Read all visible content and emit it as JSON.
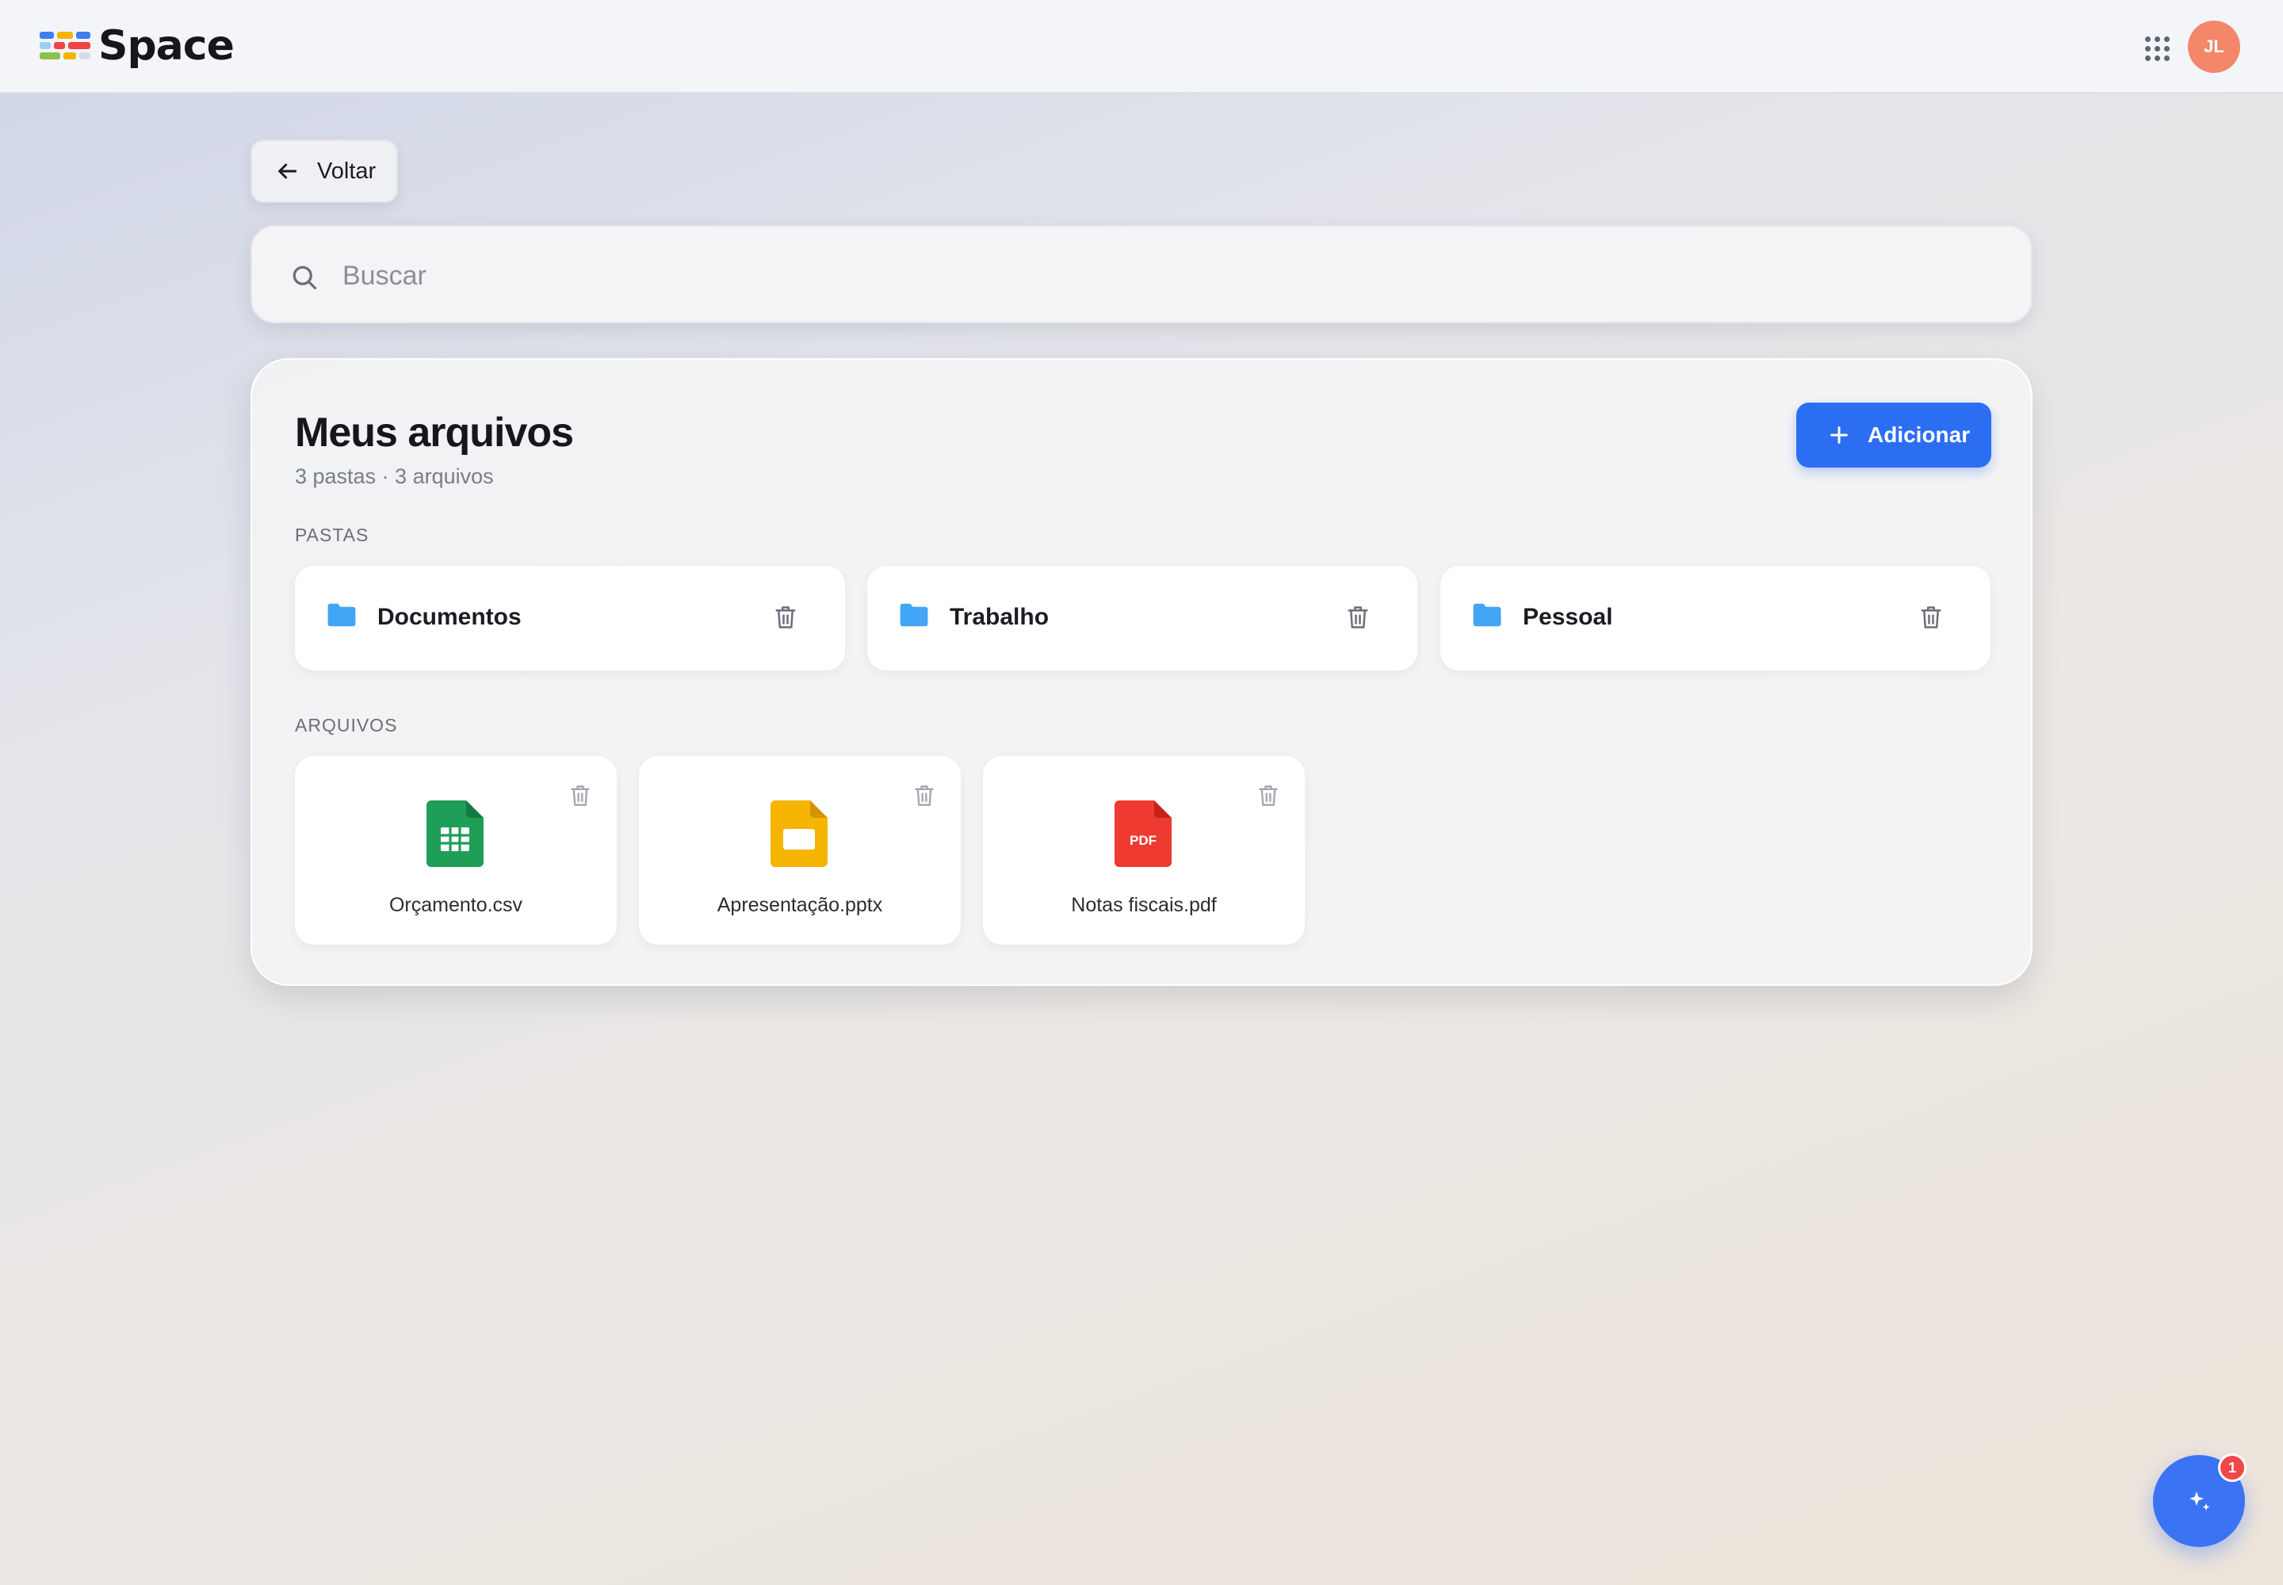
{
  "app": {
    "name": "Space",
    "user_initials": "JL"
  },
  "nav": {
    "back_label": "Voltar"
  },
  "search": {
    "placeholder": "Buscar"
  },
  "files_page": {
    "title": "Meus arquivos",
    "summary": "3 pastas · 3 arquivos",
    "add_label": "Adicionar",
    "folders_section": "PASTAS",
    "files_section": "ARQUIVOS",
    "folders": [
      {
        "name": "Documentos"
      },
      {
        "name": "Trabalho"
      },
      {
        "name": "Pessoal"
      }
    ],
    "files": [
      {
        "name": "Orçamento.csv",
        "type": "spreadsheet",
        "color": "#1e9e56"
      },
      {
        "name": "Apresentação.pptx",
        "type": "slides",
        "color": "#f5b400"
      },
      {
        "name": "Notas fiscais.pdf",
        "type": "pdf",
        "color": "#ee3a30",
        "icon_text": "PDF"
      }
    ]
  },
  "assistant": {
    "notification_count": "1"
  },
  "colors": {
    "accent": "#2b6ef2",
    "folder": "#42a5f5",
    "avatar": "#f4866a",
    "badge": "#ef4848"
  }
}
